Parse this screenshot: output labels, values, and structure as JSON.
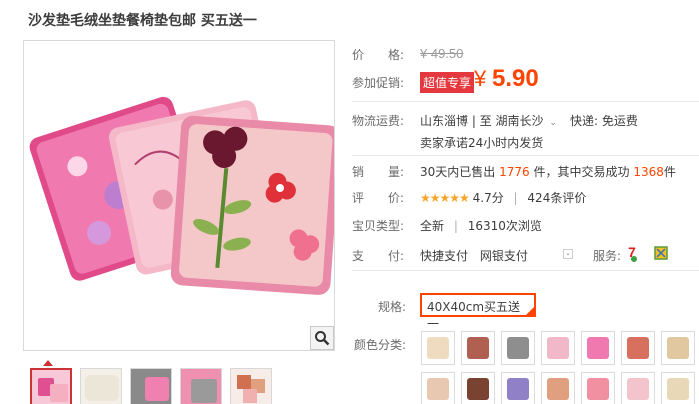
{
  "product": {
    "title": "沙发垫毛绒坐垫餐椅垫包邮 买五送一"
  },
  "price": {
    "label": "价　　格:",
    "original": "¥ 49.50",
    "promo_label": "参加促销:",
    "promo_badge": "超值专享",
    "currency": "¥",
    "value": "5.90"
  },
  "logistics": {
    "label": "物流运费:",
    "route": "山东淄博 | 至  湖南长沙",
    "shipping": "快递: 免运费",
    "promise": "卖家承诺24小时内发货"
  },
  "sales": {
    "label": "销　　量:",
    "prefix": "30天内已售出",
    "count": "1776",
    "middle": "件，其中交易成功",
    "success": "1368",
    "suffix": "件"
  },
  "rating": {
    "label": "评　　价:",
    "stars": "★★★★★",
    "score": "4.7分",
    "reviews": "424条评价"
  },
  "item_type": {
    "label": "宝贝类型:",
    "condition": "全新",
    "views": "16310次浏览"
  },
  "payment": {
    "label": "支　　付:",
    "method1": "快捷支付",
    "method2": "网银支付",
    "service_label": "服务:"
  },
  "spec": {
    "label": "规格:",
    "selected": "40X40cm买五送一"
  },
  "color": {
    "label": "颜色分类:",
    "swatches": [
      {
        "name": "beige",
        "color": "#efdcc0"
      },
      {
        "name": "brown-print",
        "color": "#b06050"
      },
      {
        "name": "gray-white",
        "color": "#8e8e8e"
      },
      {
        "name": "pink-floral",
        "color": "#f0b8c8"
      },
      {
        "name": "hot-pink",
        "color": "#f07ab0"
      },
      {
        "name": "red-floral",
        "color": "#d87060"
      },
      {
        "name": "cream-brown",
        "color": "#e2c8a0"
      },
      {
        "name": "tan",
        "color": "#e8c8b0"
      },
      {
        "name": "chocolate",
        "color": "#7a4230"
      },
      {
        "name": "purple",
        "color": "#9080c8"
      },
      {
        "name": "multi-floral",
        "color": "#e0a080"
      },
      {
        "name": "pink-flower",
        "color": "#f090a0"
      },
      {
        "name": "light-pink",
        "color": "#f4c4cc"
      },
      {
        "name": "cream",
        "color": "#e8d8b8"
      }
    ]
  }
}
